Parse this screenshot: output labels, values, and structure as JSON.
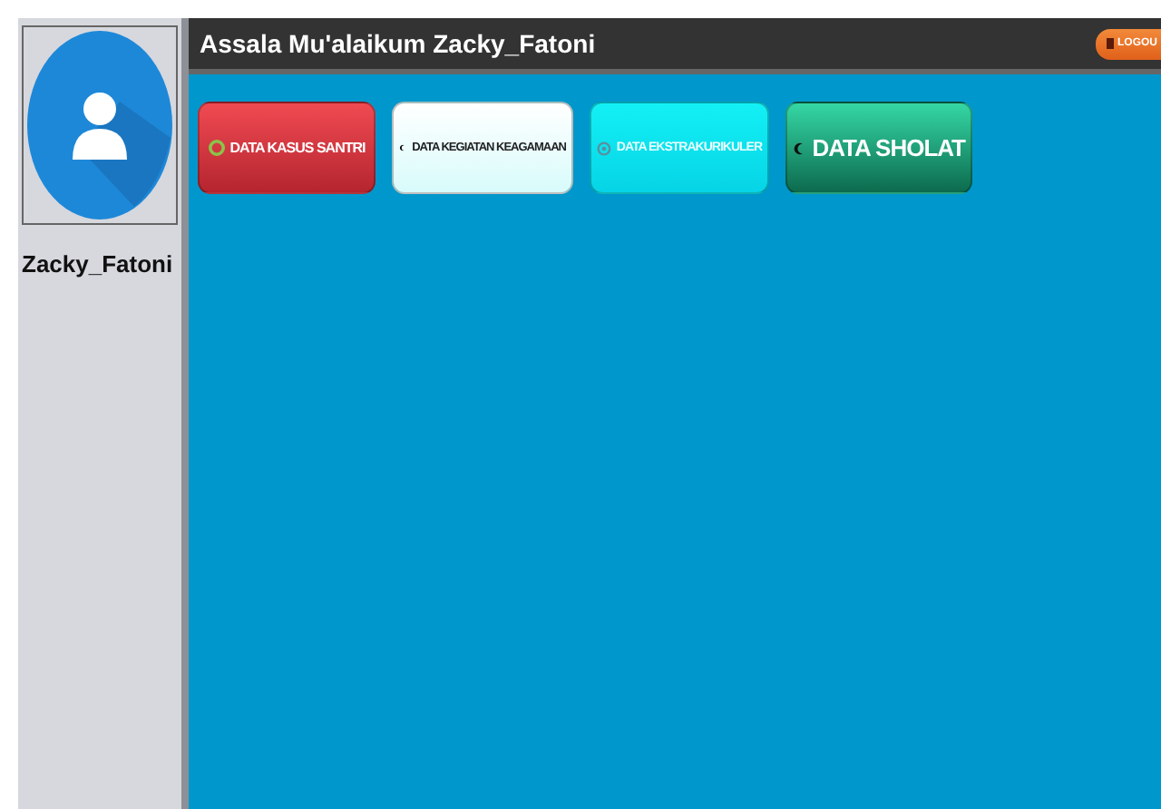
{
  "user": {
    "name": "Zacky_Fatoni"
  },
  "header": {
    "greeting": "Assala Mu'alaikum Zacky_Fatoni",
    "logout": "LOGOU"
  },
  "buttons": [
    {
      "label": "DATA KASUS SANTRI",
      "kind": "danger"
    },
    {
      "label": "DATA KEGIATAN KEAGAMAAN",
      "kind": "light"
    },
    {
      "label": "DATA EKSTRAKURIKULER",
      "kind": "info"
    },
    {
      "label": "DATA SHOLAT",
      "kind": "success"
    }
  ]
}
